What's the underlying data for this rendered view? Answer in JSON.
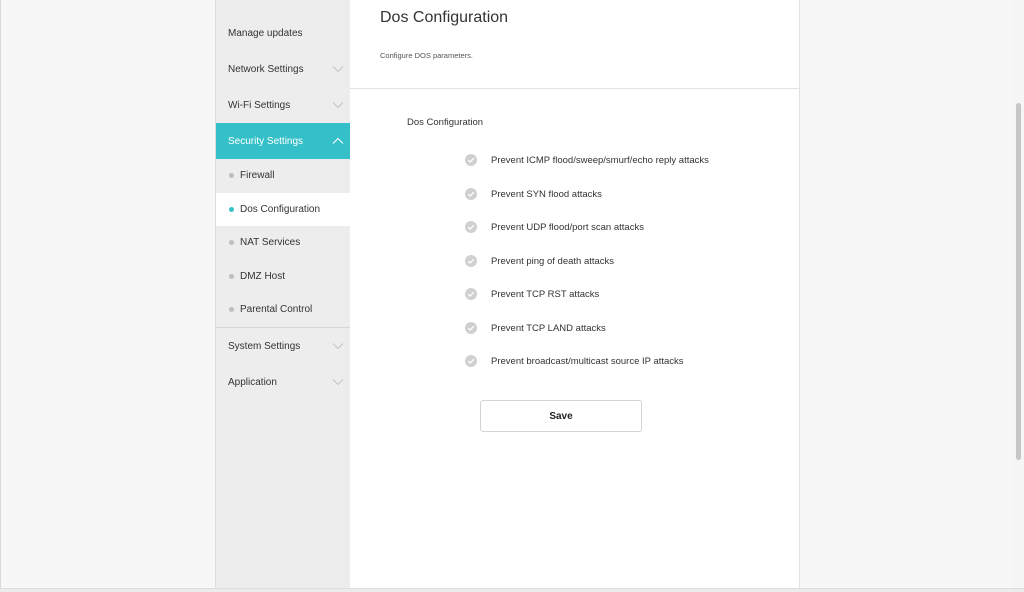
{
  "sidebar": {
    "items": [
      {
        "label": "Manage updates"
      },
      {
        "label": "Network Settings"
      },
      {
        "label": "Wi-Fi Settings"
      },
      {
        "label": "Security Settings"
      },
      {
        "label": "System Settings"
      },
      {
        "label": "Application"
      }
    ],
    "security_sub_items": [
      {
        "label": "Firewall"
      },
      {
        "label": "Dos Configuration"
      },
      {
        "label": "NAT Services"
      },
      {
        "label": "DMZ Host"
      },
      {
        "label": "Parental Control"
      }
    ],
    "active_section": "Security Settings",
    "selected_sub_item": "Dos Configuration"
  },
  "main": {
    "title": "Dos Configuration",
    "subtitle": "Configure DOS parameters.",
    "section_title": "Dos Configuration",
    "options": [
      {
        "label": "Prevent ICMP flood/sweep/smurf/echo reply attacks",
        "checked": true
      },
      {
        "label": "Prevent SYN flood attacks",
        "checked": true
      },
      {
        "label": "Prevent UDP flood/port scan attacks",
        "checked": true
      },
      {
        "label": "Prevent ping of death attacks",
        "checked": true
      },
      {
        "label": "Prevent TCP RST attacks",
        "checked": true
      },
      {
        "label": "Prevent TCP LAND attacks",
        "checked": true
      },
      {
        "label": "Prevent broadcast/multicast source IP attacks",
        "checked": true
      }
    ],
    "save_label": "Save"
  },
  "colors": {
    "accent": "#35c0c9",
    "sidebar_bg": "#ededed",
    "checkbox_gray": "#d0d0d0"
  },
  "icons": {
    "chevron": "chevron-down-icon",
    "chevron_up": "chevron-up-icon",
    "check": "check-circle-icon"
  }
}
